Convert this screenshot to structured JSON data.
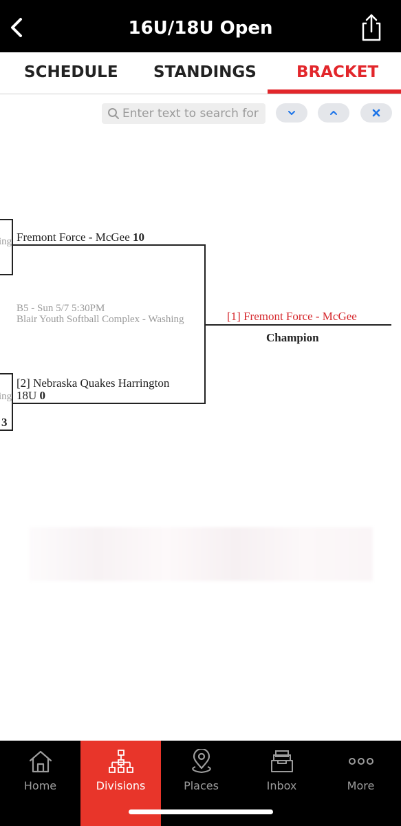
{
  "header": {
    "title": "16U/18U Open",
    "back_icon": "chevron-left-icon",
    "share_icon": "share-icon"
  },
  "tabs": [
    {
      "label": "SCHEDULE",
      "active": false
    },
    {
      "label": "STANDINGS",
      "active": false
    },
    {
      "label": "BRACKET",
      "active": true
    }
  ],
  "search": {
    "placeholder": "Enter text to search for",
    "value": ""
  },
  "bracket": {
    "left_partial_top": "ing",
    "left_partial_bottom": "ing",
    "left_partial_score": "3",
    "team1": {
      "name": "Fremont Force - McGee",
      "score": "10"
    },
    "game_info_line1": "B5 - Sun 5/7 5:30PM",
    "game_info_line2": "Blair Youth Softball Complex - Washing",
    "team2": {
      "name_line1": "[2] Nebraska Quakes Harrington",
      "name_line2": "18U",
      "score": "0"
    },
    "winner": "[1] Fremont Force - McGee",
    "winner_label": "Champion"
  },
  "bottom_nav": [
    {
      "label": "Home",
      "icon": "home-icon",
      "active": false
    },
    {
      "label": "Divisions",
      "icon": "divisions-icon",
      "active": true
    },
    {
      "label": "Places",
      "icon": "map-pin-icon",
      "active": false
    },
    {
      "label": "Inbox",
      "icon": "inbox-icon",
      "active": false
    },
    {
      "label": "More",
      "icon": "more-icon",
      "active": false
    }
  ],
  "colors": {
    "accent": "#e2262b",
    "nav_active": "#e8352a",
    "header_bg": "#000000"
  }
}
